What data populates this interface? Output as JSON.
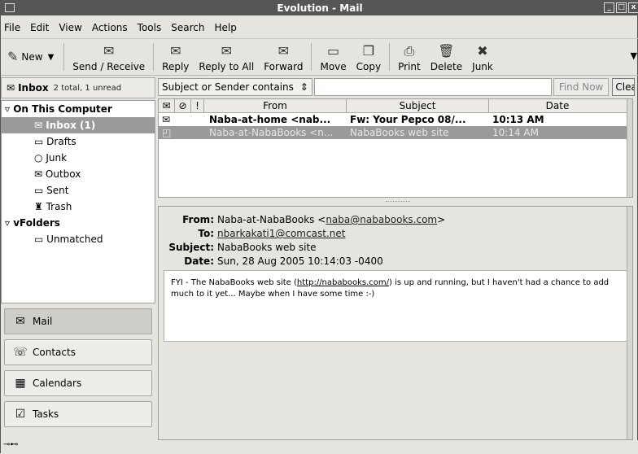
{
  "window": {
    "title": "Evolution - Mail"
  },
  "menu": [
    {
      "label": "File"
    },
    {
      "label": "Edit"
    },
    {
      "label": "View"
    },
    {
      "label": "Actions"
    },
    {
      "label": "Tools"
    },
    {
      "label": "Search"
    },
    {
      "label": "Help"
    }
  ],
  "toolbar": {
    "new_label": "New",
    "send_receive_label": "Send / Receive",
    "reply_label": "Reply",
    "reply_all_label": "Reply to All",
    "forward_label": "Forward",
    "move_label": "Move",
    "copy_label": "Copy",
    "print_label": "Print",
    "delete_label": "Delete",
    "junk_label": "Junk"
  },
  "folder_header": {
    "name": "Inbox",
    "count": "2 total, 1 unread"
  },
  "folders": {
    "on_this_computer": "On This Computer",
    "inbox": "Inbox (1)",
    "drafts": "Drafts",
    "junk": "Junk",
    "outbox": "Outbox",
    "sent": "Sent",
    "trash": "Trash",
    "vfolders": "vFolders",
    "unmatched": "Unmatched"
  },
  "switcher": {
    "mail": "Mail",
    "contacts": "Contacts",
    "calendars": "Calendars",
    "tasks": "Tasks"
  },
  "search": {
    "scope": "Subject or Sender contains",
    "value": "",
    "find_label": "Find Now",
    "clear_label": "Clear"
  },
  "columns": {
    "from": "From",
    "subject": "Subject",
    "date": "Date"
  },
  "messages": [
    {
      "from": "Naba-at-home <nab...",
      "subject": "Fw: Your Pepco 08/...",
      "date": "10:13 AM",
      "unread": true
    },
    {
      "from": "Naba-at-NabaBooks <n...",
      "subject": "NabaBooks web site",
      "date": "10:14 AM",
      "unread": false
    }
  ],
  "preview": {
    "from_key": "From:",
    "from_name": "Naba-at-NabaBooks <",
    "from_email": "naba@nababooks.com",
    "from_close": ">",
    "to_key": "To:",
    "to_email": "nbarkakati1@comcast.net",
    "subject_key": "Subject:",
    "subject": "NabaBooks web site",
    "date_key": "Date:",
    "date": "Sun, 28 Aug 2005 10:14:03 -0400",
    "body_pre": "FYI - The NabaBooks web site (",
    "body_link": "http://nababooks.com/",
    "body_post": ") is up and running, but I haven't had a chance to add much to it yet... Maybe when I have some time :-)"
  },
  "icons": [
    "new-icon",
    "send-receive-icon",
    "reply-icon",
    "reply-all-icon",
    "forward-icon",
    "move-icon",
    "copy-icon",
    "print-icon",
    "delete-icon",
    "junk-icon",
    "mail-icon",
    "contacts-icon",
    "calendar-icon",
    "tasks-icon"
  ]
}
